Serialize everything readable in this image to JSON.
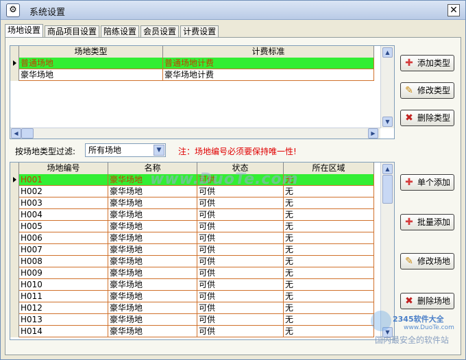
{
  "window": {
    "title": "系统设置",
    "close": "✕"
  },
  "tabs": [
    "场地设置",
    "商品项目设置",
    "陪练设置",
    "会员设置",
    "计费设置"
  ],
  "type_grid": {
    "headers": [
      "场地类型",
      "计费标准"
    ],
    "rows": [
      [
        "普通场地",
        "普通场地计费"
      ],
      [
        "豪华场地",
        "豪华场地计费"
      ]
    ]
  },
  "type_buttons": {
    "add": "添加类型",
    "edit": "修改类型",
    "delete": "删除类型"
  },
  "filter": {
    "label": "按场地类型过滤:",
    "value": "所有场地"
  },
  "note": "注：场地编号必须要保持唯一性!",
  "venue_grid": {
    "headers": [
      "场地编号",
      "名称",
      "状态",
      "所在区域"
    ],
    "rows": [
      [
        "H001",
        "豪华场地",
        "可供",
        "无"
      ],
      [
        "H002",
        "豪华场地",
        "可供",
        "无"
      ],
      [
        "H003",
        "豪华场地",
        "可供",
        "无"
      ],
      [
        "H004",
        "豪华场地",
        "可供",
        "无"
      ],
      [
        "H005",
        "豪华场地",
        "可供",
        "无"
      ],
      [
        "H006",
        "豪华场地",
        "可供",
        "无"
      ],
      [
        "H007",
        "豪华场地",
        "可供",
        "无"
      ],
      [
        "H008",
        "豪华场地",
        "可供",
        "无"
      ],
      [
        "H009",
        "豪华场地",
        "可供",
        "无"
      ],
      [
        "H010",
        "豪华场地",
        "可供",
        "无"
      ],
      [
        "H011",
        "豪华场地",
        "可供",
        "无"
      ],
      [
        "H012",
        "豪华场地",
        "可供",
        "无"
      ],
      [
        "H013",
        "豪华场地",
        "可供",
        "无"
      ],
      [
        "H014",
        "豪华场地",
        "可供",
        "无"
      ]
    ]
  },
  "venue_buttons": {
    "add_single": "单个添加",
    "add_batch": "批量添加",
    "edit": "修改场地",
    "delete": "删除场地"
  },
  "watermarks": {
    "main": "www.DuoTe.com",
    "brand": "2345软件大全",
    "url": "www.DuoTe.com",
    "slogan": "国内最安全的软件站"
  }
}
